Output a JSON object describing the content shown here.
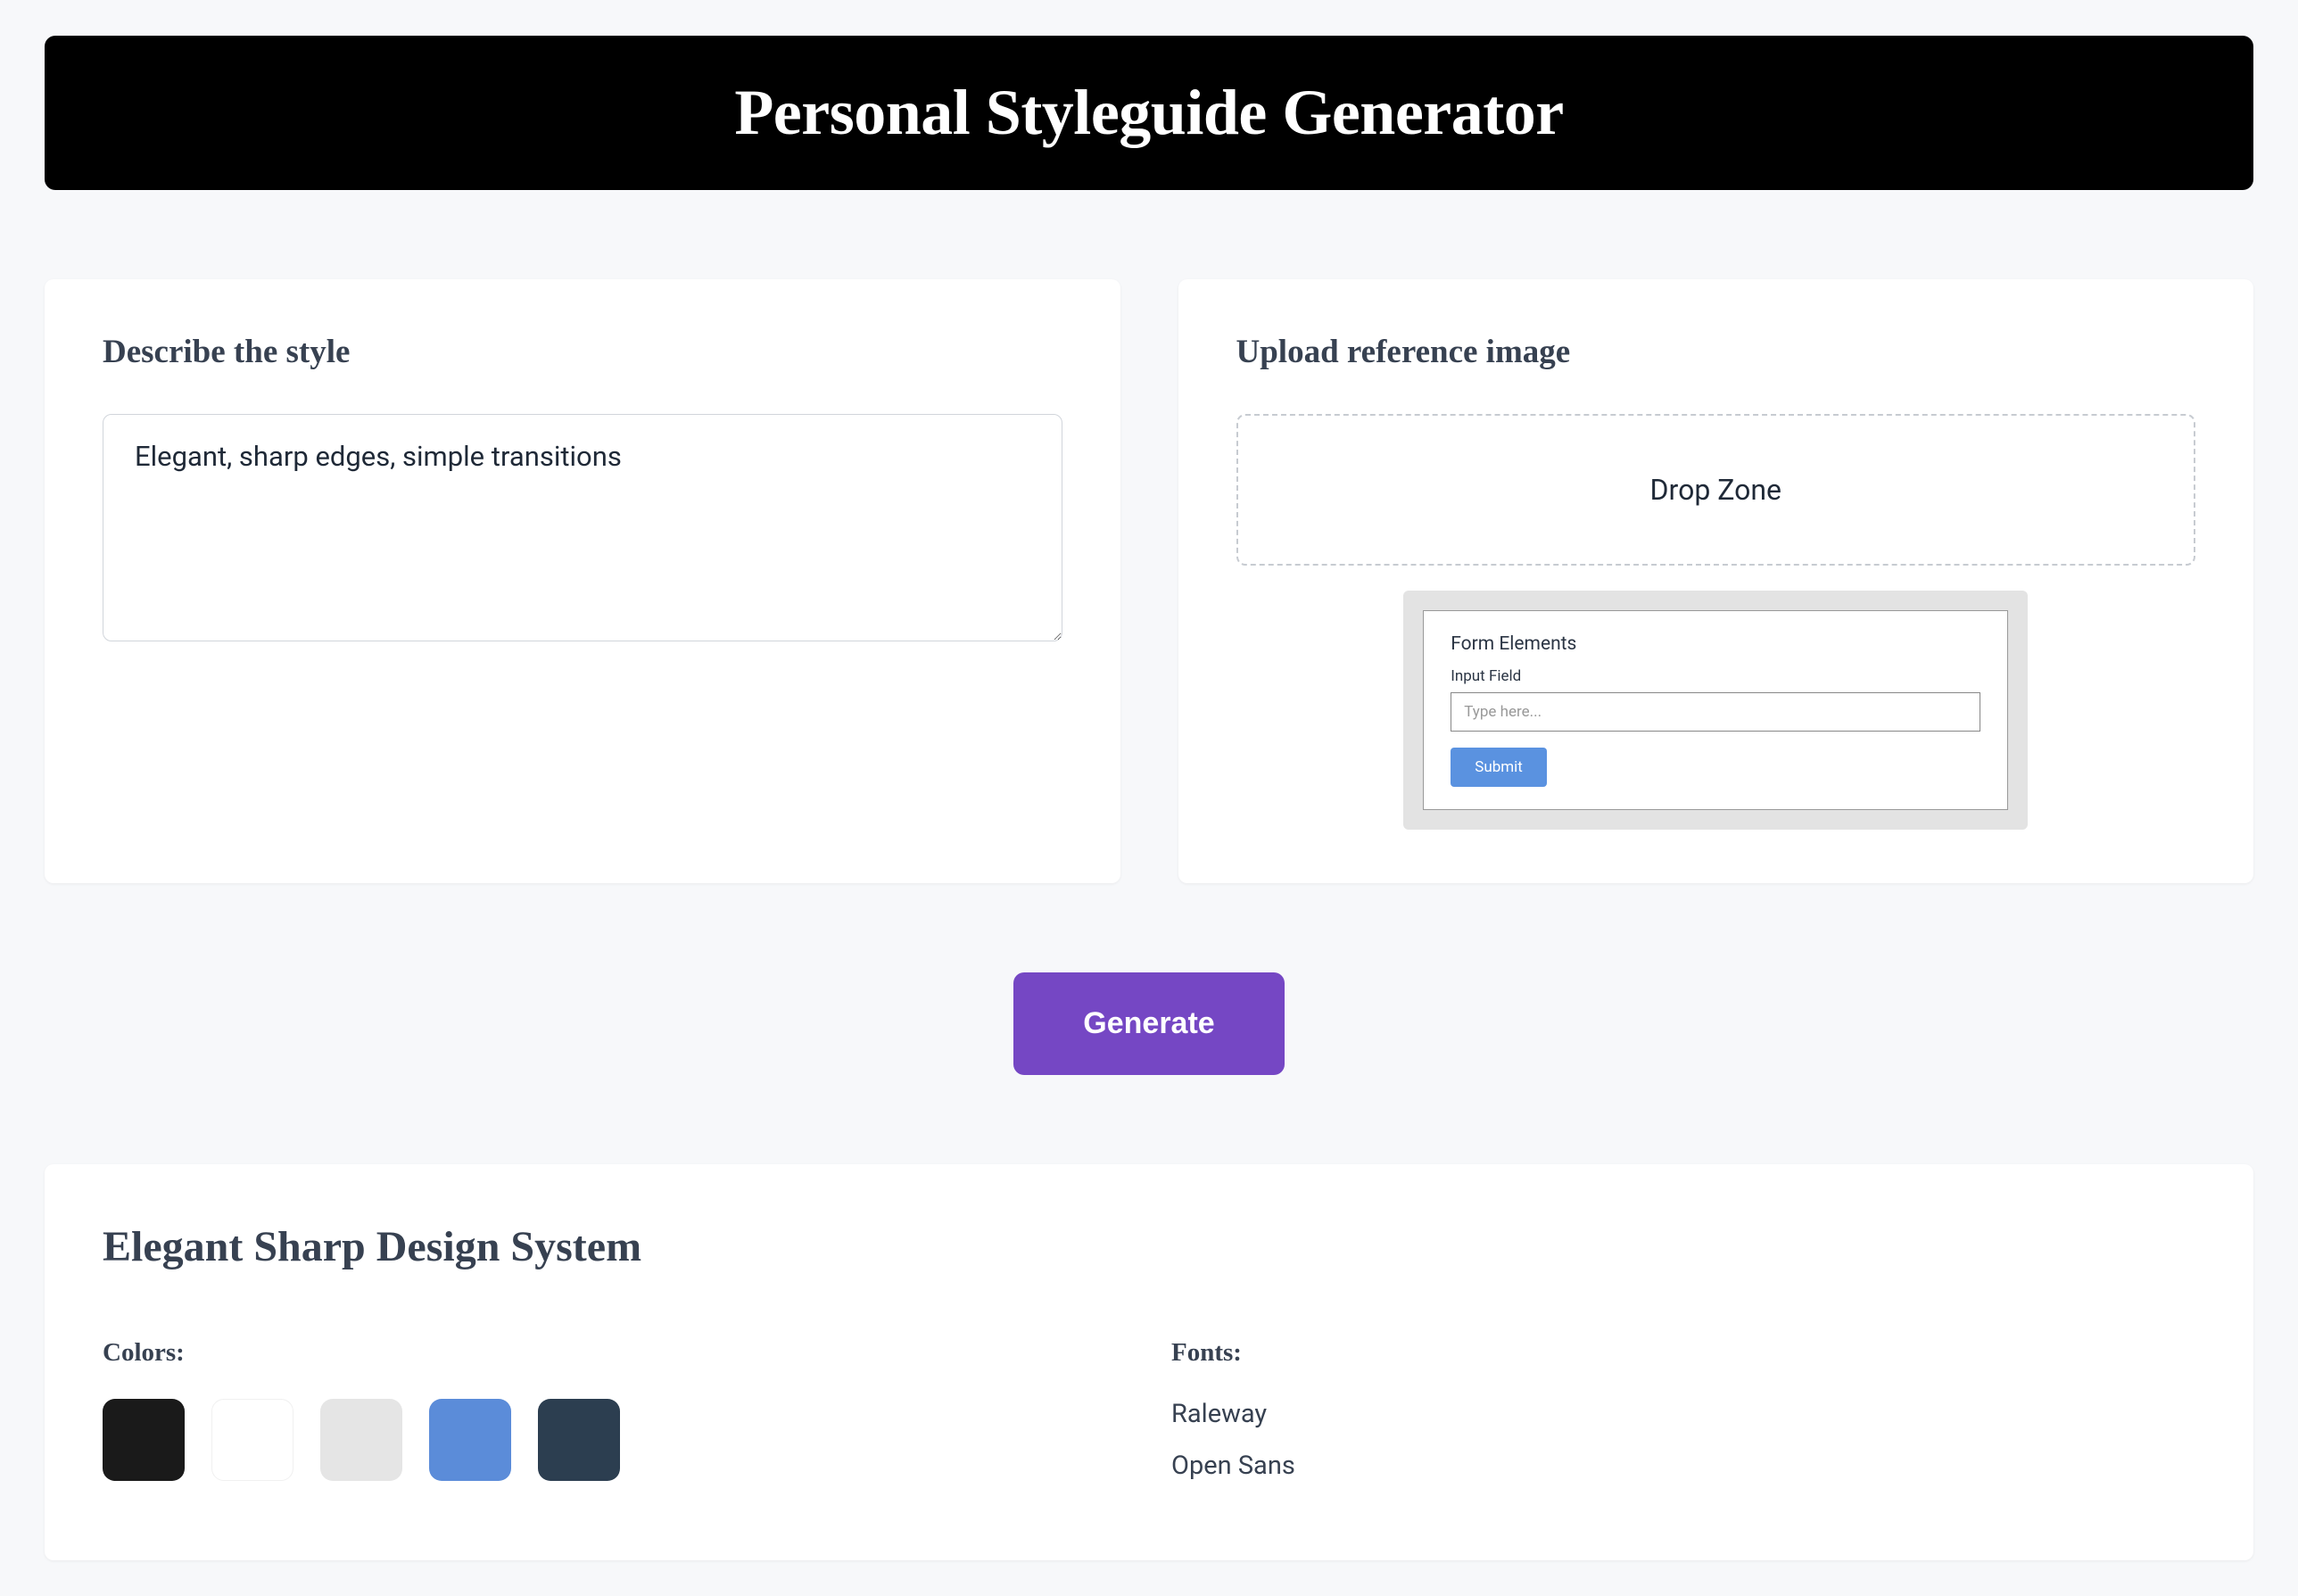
{
  "header": {
    "title": "Personal Styleguide Generator"
  },
  "describe": {
    "title": "Describe the style",
    "value": "Elegant, sharp edges, simple transitions"
  },
  "upload": {
    "title": "Upload reference image",
    "drop_zone_label": "Drop Zone",
    "preview": {
      "heading": "Form Elements",
      "input_label": "Input Field",
      "input_placeholder": "Type here...",
      "submit_label": "Submit"
    }
  },
  "generate_label": "Generate",
  "result": {
    "title": "Elegant Sharp Design System",
    "colors": {
      "label": "Colors:",
      "swatches": [
        "#1a1a1a",
        "#ffffff",
        "#e5e5e5",
        "#5b8cd9",
        "#2c3e50"
      ]
    },
    "fonts": {
      "label": "Fonts:",
      "list": [
        "Raleway",
        "Open Sans"
      ]
    }
  }
}
